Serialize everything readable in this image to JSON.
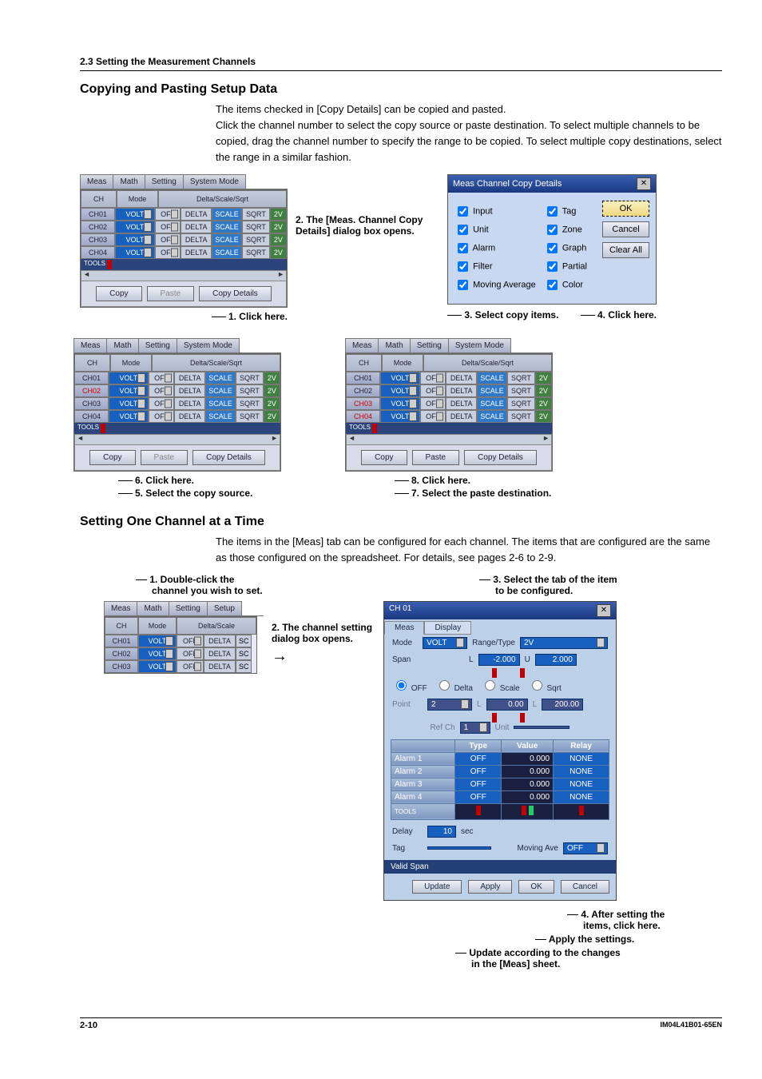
{
  "section_header": "2.3  Setting the Measurement Channels",
  "copy_paste": {
    "title": "Copying and Pasting Setup Data",
    "body": "The items checked in [Copy Details] can be copied and pasted.\nClick the channel number to select the copy source or paste destination. To select multiple channels to be copied, drag the channel number to specify the range to be copied. To select multiple copy destinations, select the range in a similar fashion.",
    "tabs": [
      "Meas",
      "Math",
      "Setting",
      "System Mode"
    ],
    "headers": {
      "ch": "CH",
      "mode": "Mode",
      "dss": "Delta/Scale/Sqrt"
    },
    "chs": [
      "CH01",
      "CH02",
      "CH03",
      "CH04"
    ],
    "tools": "TOOLS",
    "mode_val": "VOLT",
    "off": "OFF",
    "delta": "DELTA",
    "scale": "SCALE",
    "sqrt": "SQRT",
    "v2": "2V",
    "btns": {
      "copy": "Copy",
      "paste": "Paste",
      "details": "Copy Details"
    },
    "c1": "1. Click here.",
    "c2a": "2. The [Meas. Channel Copy",
    "c2b": "Details] dialog box opens.",
    "c3": "3. Select copy items.",
    "c4": "4. Click here.",
    "c5": "5. Select the copy source.",
    "c6": "6. Click here.",
    "c7": "7. Select the paste destination.",
    "c8": "8. Click here."
  },
  "dlg": {
    "title": "Meas Channel Copy Details",
    "ok": "OK",
    "cancel": "Cancel",
    "clear": "Clear All",
    "items_left": [
      "Input",
      "Unit",
      "Alarm",
      "Filter",
      "Moving Average"
    ],
    "items_right": [
      "Tag",
      "Zone",
      "Graph",
      "Partial",
      "Color"
    ]
  },
  "one_channel": {
    "title": "Setting One Channel at a Time",
    "body": "The items in the [Meas] tab can be configured for each channel. The items that are configured are the same as those configured on the spreadsheet. For details, see pages 2-6 to 2-9.",
    "small_tabs": [
      "Meas",
      "Math",
      "Setting",
      "Setup"
    ],
    "small_headers": {
      "ch": "CH",
      "mode": "Mode",
      "ds": "Delta/Scale"
    },
    "small_chs": [
      "CH01",
      "CH02",
      "CH03"
    ],
    "c1a": "1. Double-click the",
    "c1b": "channel you wish to set.",
    "c2a": "2. The channel setting",
    "c2b": "dialog box opens.",
    "c3a": "3. Select the tab of the item",
    "c3b": "to be configured.",
    "c4a": "4. After setting the",
    "c4b": "items, click here.",
    "c5": "Apply the settings.",
    "c6a": "Update according to the changes",
    "c6b": "in the [Meas] sheet."
  },
  "chdlg": {
    "title": "CH 01",
    "tabs": [
      "Meas",
      "Display"
    ],
    "mode_label": "Mode",
    "mode_val": "VOLT",
    "range_label": "Range/Type",
    "range_val": "2V",
    "span_label": "Span",
    "span_l": "-2.000",
    "span_u": "2.000",
    "L": "L",
    "U": "U",
    "radios": [
      "OFF",
      "Delta",
      "Scale",
      "Sqrt"
    ],
    "point_label": "Point",
    "point_val": "2",
    "point_l": "0.00",
    "point_u": "200.00",
    "refch_label": "Ref Ch",
    "refch_val": "1",
    "unit_label": "Unit",
    "tbl": {
      "type": "Type",
      "value": "Value",
      "relay": "Relay",
      "rows": [
        "Alarm 1",
        "Alarm 2",
        "Alarm 3",
        "Alarm 4"
      ],
      "off": "OFF",
      "val": "0.000",
      "none": "NONE"
    },
    "tools": "TOOLS",
    "delay_label": "Delay",
    "delay_val": "10",
    "sec": "sec",
    "tag_label": "Tag",
    "mavg_label": "Moving Ave",
    "mavg_val": "OFF",
    "valid_span": "Valid Span",
    "btns": {
      "update": "Update",
      "apply": "Apply",
      "ok": "OK",
      "cancel": "Cancel"
    }
  },
  "footer": {
    "page": "2-10",
    "doc": "IM04L41B01-65EN"
  }
}
